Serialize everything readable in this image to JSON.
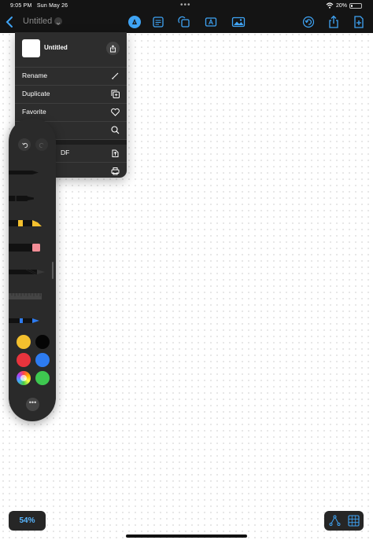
{
  "status_bar": {
    "time": "9:05 PM",
    "date": "Sun May 26",
    "battery": "20%",
    "battery_level": 0.2
  },
  "toolbar": {
    "doc_title": "Untitled",
    "icons": [
      "pencil-tip-icon",
      "text-box-icon",
      "shapes-icon",
      "text-frame-icon",
      "image-icon",
      "undo-icon",
      "share-icon",
      "add-page-icon"
    ]
  },
  "menu": {
    "doc_name": "Untitled",
    "items": [
      {
        "label": "Rename",
        "icon": "pencil-icon"
      },
      {
        "label": "Duplicate",
        "icon": "duplicate-icon"
      },
      {
        "label": "Favorite",
        "icon": "heart-icon"
      },
      {
        "label": "",
        "icon": "search-icon"
      },
      {
        "label": "DF",
        "icon": "export-icon"
      },
      {
        "label": "",
        "icon": "print-icon"
      }
    ]
  },
  "palette": {
    "tools": [
      "fountain-pen",
      "marker",
      "highlighter",
      "eraser",
      "pencil",
      "ruler",
      "lasso"
    ],
    "colors": [
      "#f4c02e",
      "#050505",
      "#e9343d",
      "#2d7bf0",
      "color-wheel",
      "#3ec850"
    ]
  },
  "footer": {
    "zoom": "54%"
  }
}
